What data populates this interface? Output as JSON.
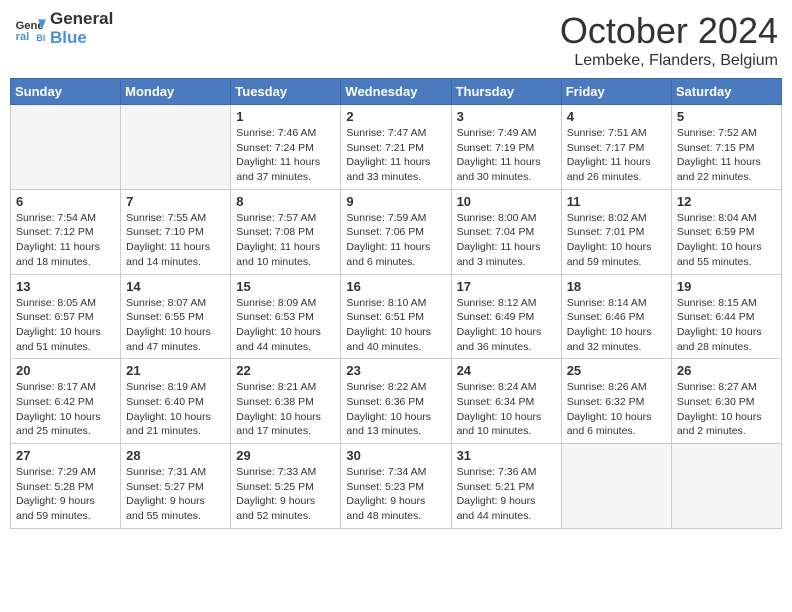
{
  "logo": {
    "line1": "General",
    "line2": "Blue"
  },
  "title": "October 2024",
  "subtitle": "Lembeke, Flanders, Belgium",
  "weekdays": [
    "Sunday",
    "Monday",
    "Tuesday",
    "Wednesday",
    "Thursday",
    "Friday",
    "Saturday"
  ],
  "weeks": [
    [
      {
        "day": "",
        "empty": true
      },
      {
        "day": "",
        "empty": true
      },
      {
        "day": "1",
        "sunrise": "7:46 AM",
        "sunset": "7:24 PM",
        "daylight": "11 hours and 37 minutes."
      },
      {
        "day": "2",
        "sunrise": "7:47 AM",
        "sunset": "7:21 PM",
        "daylight": "11 hours and 33 minutes."
      },
      {
        "day": "3",
        "sunrise": "7:49 AM",
        "sunset": "7:19 PM",
        "daylight": "11 hours and 30 minutes."
      },
      {
        "day": "4",
        "sunrise": "7:51 AM",
        "sunset": "7:17 PM",
        "daylight": "11 hours and 26 minutes."
      },
      {
        "day": "5",
        "sunrise": "7:52 AM",
        "sunset": "7:15 PM",
        "daylight": "11 hours and 22 minutes."
      }
    ],
    [
      {
        "day": "6",
        "sunrise": "7:54 AM",
        "sunset": "7:12 PM",
        "daylight": "11 hours and 18 minutes."
      },
      {
        "day": "7",
        "sunrise": "7:55 AM",
        "sunset": "7:10 PM",
        "daylight": "11 hours and 14 minutes."
      },
      {
        "day": "8",
        "sunrise": "7:57 AM",
        "sunset": "7:08 PM",
        "daylight": "11 hours and 10 minutes."
      },
      {
        "day": "9",
        "sunrise": "7:59 AM",
        "sunset": "7:06 PM",
        "daylight": "11 hours and 6 minutes."
      },
      {
        "day": "10",
        "sunrise": "8:00 AM",
        "sunset": "7:04 PM",
        "daylight": "11 hours and 3 minutes."
      },
      {
        "day": "11",
        "sunrise": "8:02 AM",
        "sunset": "7:01 PM",
        "daylight": "10 hours and 59 minutes."
      },
      {
        "day": "12",
        "sunrise": "8:04 AM",
        "sunset": "6:59 PM",
        "daylight": "10 hours and 55 minutes."
      }
    ],
    [
      {
        "day": "13",
        "sunrise": "8:05 AM",
        "sunset": "6:57 PM",
        "daylight": "10 hours and 51 minutes."
      },
      {
        "day": "14",
        "sunrise": "8:07 AM",
        "sunset": "6:55 PM",
        "daylight": "10 hours and 47 minutes."
      },
      {
        "day": "15",
        "sunrise": "8:09 AM",
        "sunset": "6:53 PM",
        "daylight": "10 hours and 44 minutes."
      },
      {
        "day": "16",
        "sunrise": "8:10 AM",
        "sunset": "6:51 PM",
        "daylight": "10 hours and 40 minutes."
      },
      {
        "day": "17",
        "sunrise": "8:12 AM",
        "sunset": "6:49 PM",
        "daylight": "10 hours and 36 minutes."
      },
      {
        "day": "18",
        "sunrise": "8:14 AM",
        "sunset": "6:46 PM",
        "daylight": "10 hours and 32 minutes."
      },
      {
        "day": "19",
        "sunrise": "8:15 AM",
        "sunset": "6:44 PM",
        "daylight": "10 hours and 28 minutes."
      }
    ],
    [
      {
        "day": "20",
        "sunrise": "8:17 AM",
        "sunset": "6:42 PM",
        "daylight": "10 hours and 25 minutes."
      },
      {
        "day": "21",
        "sunrise": "8:19 AM",
        "sunset": "6:40 PM",
        "daylight": "10 hours and 21 minutes."
      },
      {
        "day": "22",
        "sunrise": "8:21 AM",
        "sunset": "6:38 PM",
        "daylight": "10 hours and 17 minutes."
      },
      {
        "day": "23",
        "sunrise": "8:22 AM",
        "sunset": "6:36 PM",
        "daylight": "10 hours and 13 minutes."
      },
      {
        "day": "24",
        "sunrise": "8:24 AM",
        "sunset": "6:34 PM",
        "daylight": "10 hours and 10 minutes."
      },
      {
        "day": "25",
        "sunrise": "8:26 AM",
        "sunset": "6:32 PM",
        "daylight": "10 hours and 6 minutes."
      },
      {
        "day": "26",
        "sunrise": "8:27 AM",
        "sunset": "6:30 PM",
        "daylight": "10 hours and 2 minutes."
      }
    ],
    [
      {
        "day": "27",
        "sunrise": "7:29 AM",
        "sunset": "5:28 PM",
        "daylight": "9 hours and 59 minutes."
      },
      {
        "day": "28",
        "sunrise": "7:31 AM",
        "sunset": "5:27 PM",
        "daylight": "9 hours and 55 minutes."
      },
      {
        "day": "29",
        "sunrise": "7:33 AM",
        "sunset": "5:25 PM",
        "daylight": "9 hours and 52 minutes."
      },
      {
        "day": "30",
        "sunrise": "7:34 AM",
        "sunset": "5:23 PM",
        "daylight": "9 hours and 48 minutes."
      },
      {
        "day": "31",
        "sunrise": "7:36 AM",
        "sunset": "5:21 PM",
        "daylight": "9 hours and 44 minutes."
      },
      {
        "day": "",
        "empty": true
      },
      {
        "day": "",
        "empty": true
      }
    ]
  ]
}
